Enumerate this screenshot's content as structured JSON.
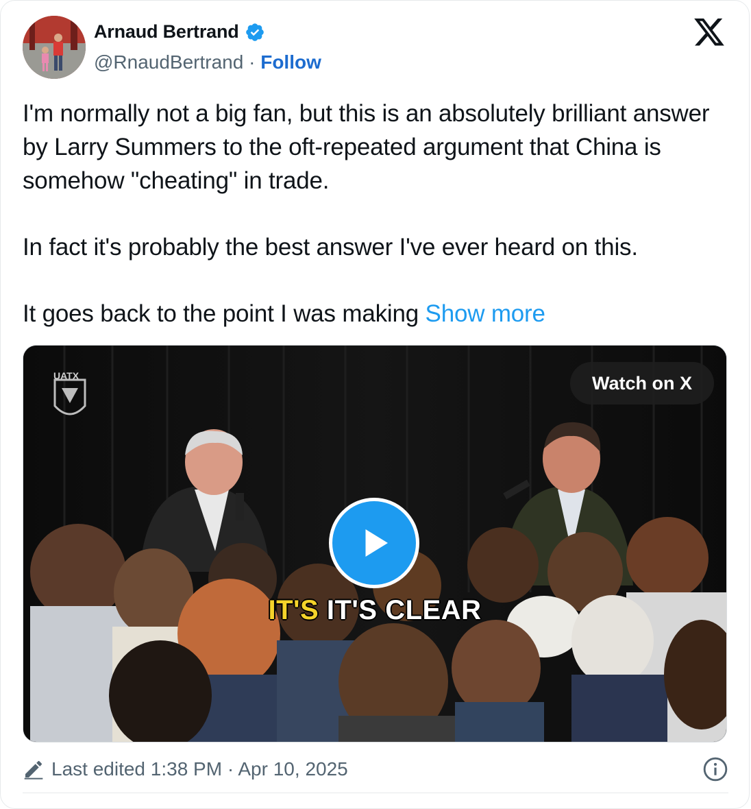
{
  "author": {
    "name": "Arnaud Bertrand",
    "handle": "@RnaudBertrand",
    "separator": "·",
    "follow_label": "Follow"
  },
  "tweet": {
    "paragraphs": [
      "I'm normally not a big fan, but this is an absolutely brilliant answer by Larry Summers to the oft-repeated argument that China is somehow \"cheating\" in trade.",
      "In fact it's probably the best answer I've ever heard on this.",
      "It goes back to the point I was making"
    ],
    "show_more_label": "Show more"
  },
  "media": {
    "watch_label": "Watch on X",
    "caption_word_1": "IT'S",
    "caption_word_2": "IT'S CLEAR",
    "watermark": "UATX"
  },
  "footer": {
    "edited_text": "Last edited 1:38 PM · Apr 10, 2025"
  },
  "colors": {
    "link": "#1d6ccf",
    "show_more": "#1d9bf0",
    "verified": "#1d9bf0",
    "caption_highlight": "#f5d32a"
  },
  "icons": [
    "verified-badge-icon",
    "x-logo-icon",
    "play-icon",
    "pencil-icon",
    "info-icon"
  ]
}
